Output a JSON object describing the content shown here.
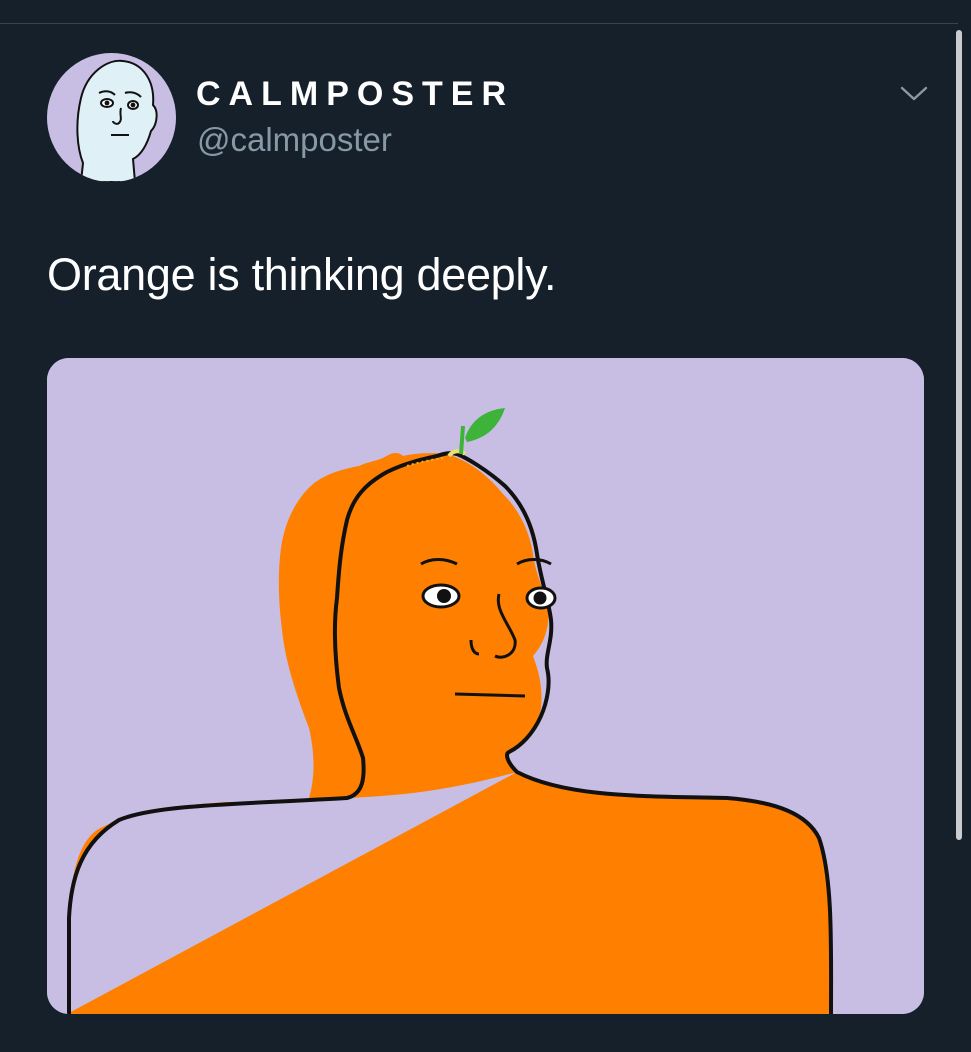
{
  "tweet": {
    "display_name": "CALMPOSTER",
    "handle": "@calmposter",
    "text": "Orange is thinking deeply.",
    "menu_icon": "chevron-down-icon",
    "avatar_icon": "wojak-avatar",
    "media_description_icon": "orange-wojak-illustration"
  },
  "colors": {
    "background": "#15202b",
    "handle": "#8899a6",
    "text": "#ffffff",
    "media_background": "#c8bee3",
    "orange": "#ff7f00",
    "leaf": "#3db33a"
  }
}
